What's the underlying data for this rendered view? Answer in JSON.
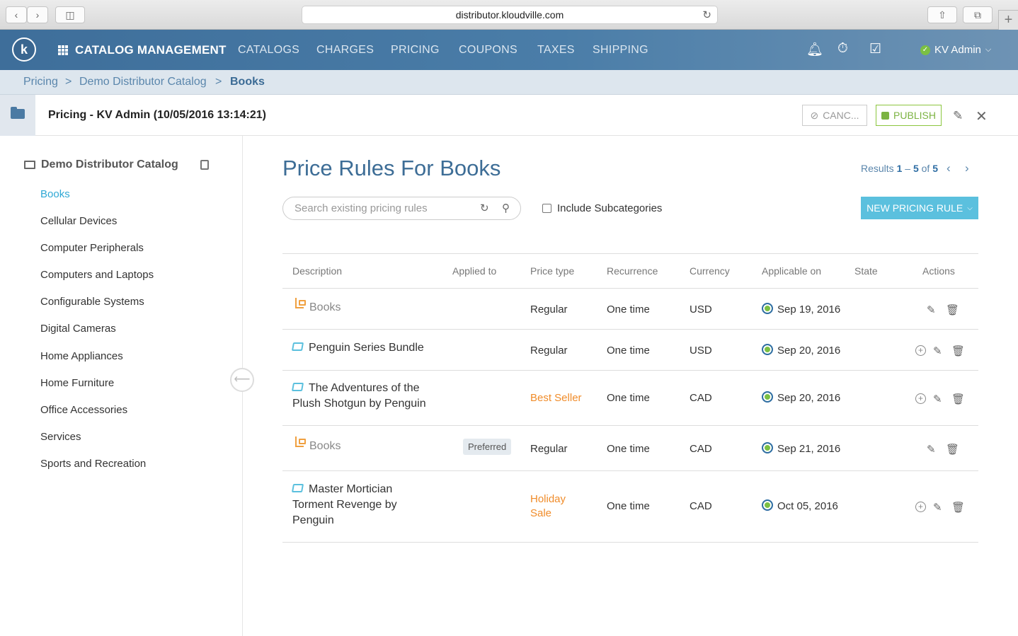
{
  "browser": {
    "url": "distributor.kloudville.com",
    "back_icon": "chevron-left-icon",
    "forward_icon": "chevron-right-icon"
  },
  "navbar": {
    "logo": "k",
    "brand": "CATALOG MANAGEMENT",
    "items": [
      "CATALOGS",
      "CHARGES",
      "PRICING",
      "COUPONS",
      "TAXES",
      "SHIPPING"
    ],
    "user": "KV Admin"
  },
  "breadcrumb": {
    "items": [
      "Pricing",
      "Demo Distributor Catalog",
      "Books"
    ],
    "separator": ">"
  },
  "titlebar": {
    "title": "Pricing - KV Admin (10/05/2016 13:14:21)",
    "cancel_label": "CANC...",
    "publish_label": "PUBLISH"
  },
  "sidebar": {
    "catalog": "Demo Distributor Catalog",
    "items": [
      "Books",
      "Cellular Devices",
      "Computer Peripherals",
      "Computers and Laptops",
      "Configurable Systems",
      "Digital Cameras",
      "Home Appliances",
      "Home Furniture",
      "Office Accessories",
      "Services",
      "Sports and Recreation"
    ],
    "active": "Books"
  },
  "main": {
    "heading": "Price Rules For Books",
    "results_prefix": "Results",
    "results_from": "1",
    "results_dash": "–",
    "results_to": "5",
    "results_of": "of",
    "results_total": "5",
    "search_placeholder": "Search existing pricing rules",
    "include_subcategories": "Include Subcategories",
    "new_rule_label": "NEW PRICING RULE"
  },
  "table": {
    "headers": [
      "Description",
      "Applied to",
      "Price type",
      "Recurrence",
      "Currency",
      "Applicable on",
      "State",
      "Actions"
    ],
    "rows": [
      {
        "kind": "category",
        "description": "Books",
        "applied_to": "",
        "price_type": "Regular",
        "recurrence": "One time",
        "currency": "USD",
        "applicable_on": "Sep 19, 2016",
        "actions": [
          "edit",
          "delete"
        ]
      },
      {
        "kind": "product",
        "description": "Penguin Series Bundle",
        "applied_to": "",
        "price_type": "Regular",
        "recurrence": "One time",
        "currency": "USD",
        "applicable_on": "Sep 20, 2016",
        "actions": [
          "add",
          "edit",
          "delete"
        ]
      },
      {
        "kind": "product",
        "description_lines": [
          "The Adventures of the",
          "Plush Shotgun by Penguin"
        ],
        "applied_to": "",
        "price_type": "Best Seller",
        "recurrence": "One time",
        "currency": "CAD",
        "applicable_on": "Sep 20, 2016",
        "actions": [
          "add",
          "edit",
          "delete"
        ]
      },
      {
        "kind": "category",
        "description": "Books",
        "applied_to": "Preferred",
        "price_type": "Regular",
        "recurrence": "One time",
        "currency": "CAD",
        "applicable_on": "Sep 21, 2016",
        "actions": [
          "edit",
          "delete"
        ]
      },
      {
        "kind": "product",
        "description_lines": [
          "Master Mortician",
          "Torment Revenge by",
          "Penguin"
        ],
        "applied_to": "",
        "price_type_lines": [
          "Holiday",
          "Sale"
        ],
        "recurrence": "One time",
        "currency": "CAD",
        "applicable_on": "Oct 05, 2016",
        "actions": [
          "add",
          "edit",
          "delete"
        ]
      }
    ]
  },
  "colors": {
    "accent": "#3d6d96",
    "link": "#2fa8d5",
    "special_price": "#f08c2a",
    "publish": "#7cb342",
    "new_button": "#5bc0de"
  }
}
